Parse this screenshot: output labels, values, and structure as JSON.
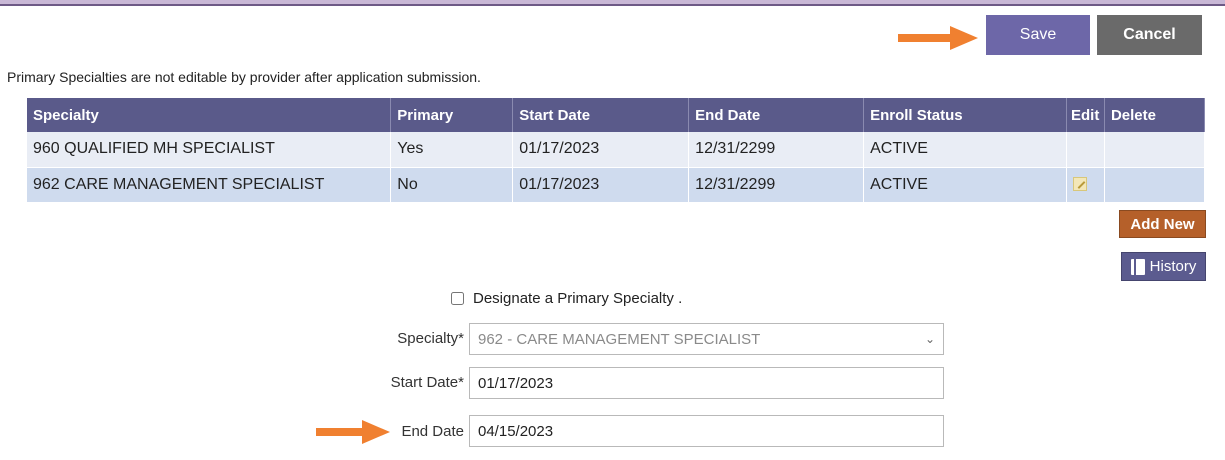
{
  "toolbar": {
    "save_label": "Save",
    "cancel_label": "Cancel"
  },
  "notice": "Primary Specialties are not editable by provider after application submission.",
  "table": {
    "headers": [
      "Specialty",
      "Primary",
      "Start Date",
      "End Date",
      "Enroll Status",
      "Edit",
      "Delete"
    ],
    "rows": [
      {
        "specialty": "960 QUALIFIED MH SPECIALIST",
        "primary": "Yes",
        "start": "01/17/2023",
        "end": "12/31/2299",
        "status": "ACTIVE"
      },
      {
        "specialty": "962 CARE MANAGEMENT SPECIALIST",
        "primary": "No",
        "start": "01/17/2023",
        "end": "12/31/2299",
        "status": "ACTIVE"
      }
    ]
  },
  "buttons": {
    "add_new": "Add New",
    "history": "History"
  },
  "form": {
    "designate_label": "Designate a Primary Specialty .",
    "specialty_label": "Specialty*",
    "specialty_value": "962 - CARE MANAGEMENT SPECIALIST",
    "start_label": "Start Date*",
    "start_value": "01/17/2023",
    "end_label": "End Date",
    "end_value": "04/15/2023"
  },
  "colors": {
    "accent_arrow": "#f08030",
    "header": "#5a5a8a",
    "save": "#6d67a8",
    "cancel": "#6a6a6a",
    "add_new": "#b5602a"
  },
  "icons": [
    "arrow-right-icon",
    "edit-icon",
    "book-icon",
    "chevron-down-icon"
  ]
}
